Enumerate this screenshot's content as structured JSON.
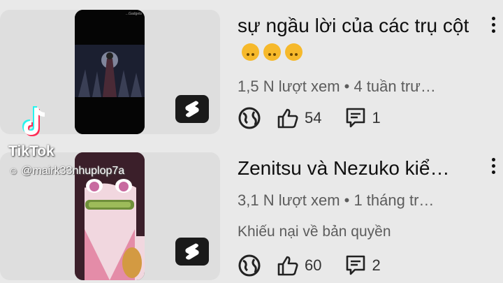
{
  "videos": [
    {
      "title": "sự ngầu lời của các trụ cột",
      "title_emoji": [
        "upside-down-face",
        "upside-down-face",
        "upside-down-face"
      ],
      "meta": "1,5 N lượt xem • 4 tuần trư…",
      "likes": "54",
      "comments": "1",
      "thumbnail_corner_label": "...Gadgets"
    },
    {
      "title": "Zenitsu và Nezuko kiể…",
      "meta": "3,1 N lượt xem • 1 tháng tr…",
      "notice": "Khiếu nại về bản quyền",
      "likes": "60",
      "comments": "2"
    }
  ],
  "watermark": {
    "brand": "TikTok",
    "username": "@mairk33nhuplop7a"
  },
  "colors": {
    "background": "#e9e9e9",
    "card": "#dedede",
    "meta_text": "#5c5c5c",
    "emoji": "#f6b92b"
  },
  "icons": [
    "globe-icon",
    "thumbs-up-icon",
    "comment-icon",
    "more-vert-icon",
    "shorts-icon",
    "tiktok-logo-icon"
  ]
}
